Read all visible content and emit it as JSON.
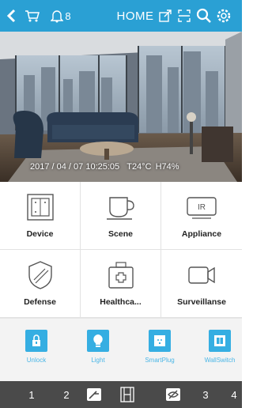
{
  "header": {
    "title": "HOME",
    "notification_count": "8",
    "icons": [
      "back-arrow-icon",
      "cart-icon",
      "bell-icon",
      "external-link-icon",
      "scan-icon",
      "search-icon",
      "settings-icon"
    ]
  },
  "camera": {
    "timestamp": "2017 / 04 / 07 10:25:05",
    "temperature": "T24°C",
    "humidity": "H74%"
  },
  "grid": {
    "items": [
      {
        "label": "Device",
        "icon": "device-icon"
      },
      {
        "label": "Scene",
        "icon": "scene-cup-icon"
      },
      {
        "label": "Appliance",
        "icon": "ir-remote-icon",
        "icon_text": "IR"
      },
      {
        "label": "Defense",
        "icon": "shield-icon"
      },
      {
        "label": "Healthca...",
        "icon": "health-kit-icon"
      },
      {
        "label": "Surveillanse",
        "icon": "camera-icon"
      }
    ]
  },
  "quick_actions": {
    "items": [
      {
        "label": "Unlock",
        "icon": "lock-icon"
      },
      {
        "label": "Light",
        "icon": "bulb-icon"
      },
      {
        "label": "SmartPlug",
        "icon": "plug-icon"
      },
      {
        "label": "WallSwitch",
        "icon": "wall-switch-icon"
      }
    ],
    "accent": "#35aee2"
  },
  "bottom_bar": {
    "items": [
      "1",
      "2",
      "3",
      "4"
    ]
  },
  "colors": {
    "header_bg": "#2aa0d4",
    "bottom_bg": "#4a4a4a"
  }
}
